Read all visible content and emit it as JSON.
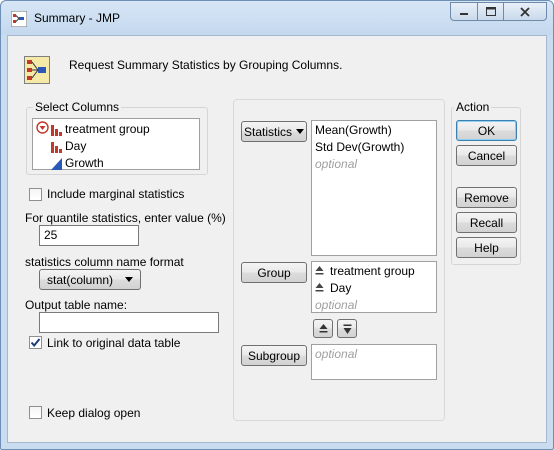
{
  "window": {
    "title": "Summary - JMP"
  },
  "header": {
    "text": "Request Summary Statistics by Grouping Columns."
  },
  "select_columns": {
    "label": "Select Columns",
    "items": [
      {
        "label": "treatment group",
        "icon": "nominal-bar-icon"
      },
      {
        "label": "Day",
        "icon": "nominal-bar-icon"
      },
      {
        "label": "Growth",
        "icon": "continuous-triangle-icon"
      }
    ]
  },
  "options": {
    "marginal_label": "Include marginal statistics",
    "marginal_checked": false,
    "quantile_label": "For quantile statistics, enter value (%)",
    "quantile_value": "25",
    "format_label": "statistics column name format",
    "format_value": "stat(column)",
    "output_label": "Output table name:",
    "output_value": "",
    "link_label": "Link to original data table",
    "link_checked": true,
    "keep_open_label": "Keep dialog open",
    "keep_open_checked": false
  },
  "roles": {
    "statistics_button": "Statistics",
    "statistics_items": [
      "Mean(Growth)",
      "Std Dev(Growth)"
    ],
    "statistics_optional": "optional",
    "group_button": "Group",
    "group_items": [
      "treatment group",
      "Day"
    ],
    "group_optional": "optional",
    "subgroup_button": "Subgroup",
    "subgroup_optional": "optional"
  },
  "action": {
    "label": "Action",
    "ok": "OK",
    "cancel": "Cancel",
    "remove": "Remove",
    "recall": "Recall",
    "help": "Help"
  },
  "colors": {
    "nominal_icon": "#c0392b",
    "continuous_icon": "#2a58b8",
    "title_bar": "#c9dcf0"
  }
}
